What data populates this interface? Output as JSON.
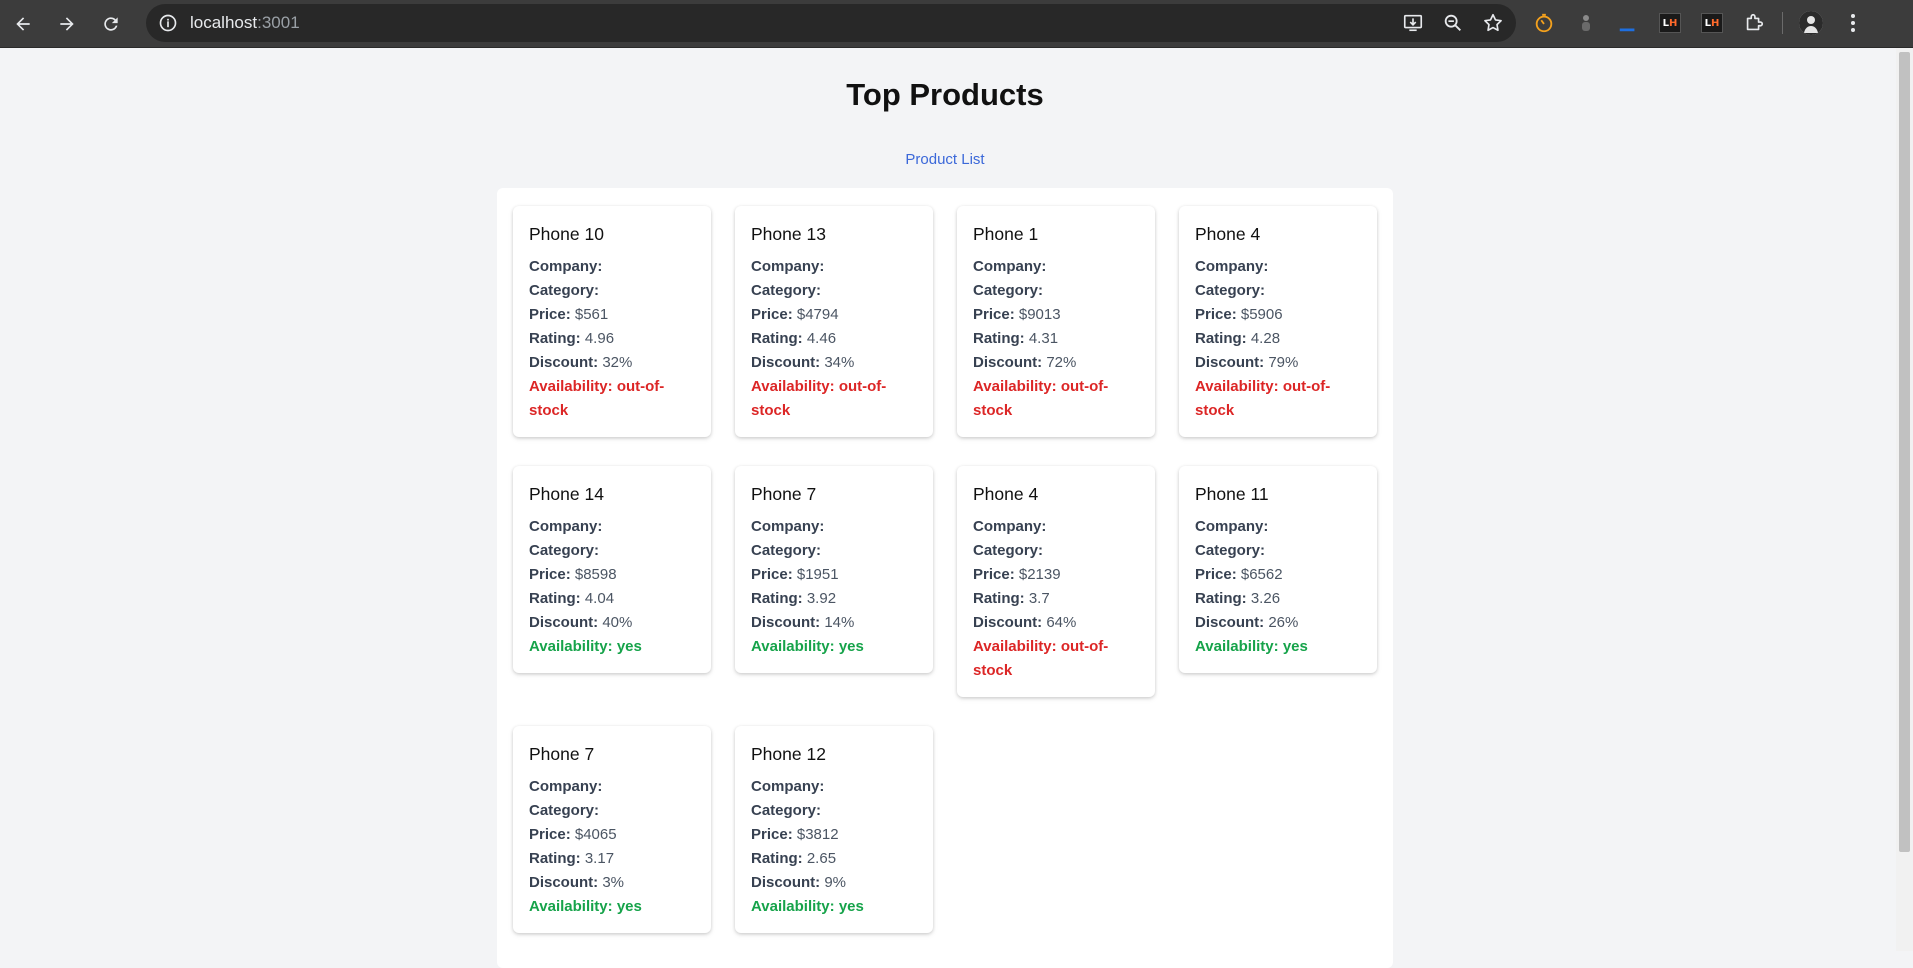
{
  "browser": {
    "url_host": "localhost",
    "url_port": ":3001"
  },
  "page": {
    "title": "Top Products",
    "link": "Product List"
  },
  "labels": {
    "company": "Company:",
    "category": "Category:",
    "price": "Price:",
    "rating": "Rating:",
    "discount": "Discount:",
    "availability": "Availability:"
  },
  "products": [
    {
      "name": "Phone 10",
      "price": "$561",
      "rating": "4.96",
      "discount": "32%",
      "availability": "out-of-stock"
    },
    {
      "name": "Phone 13",
      "price": "$4794",
      "rating": "4.46",
      "discount": "34%",
      "availability": "out-of-stock"
    },
    {
      "name": "Phone 1",
      "price": "$9013",
      "rating": "4.31",
      "discount": "72%",
      "availability": "out-of-stock"
    },
    {
      "name": "Phone 4",
      "price": "$5906",
      "rating": "4.28",
      "discount": "79%",
      "availability": "out-of-stock"
    },
    {
      "name": "Phone 14",
      "price": "$8598",
      "rating": "4.04",
      "discount": "40%",
      "availability": "yes"
    },
    {
      "name": "Phone 7",
      "price": "$1951",
      "rating": "3.92",
      "discount": "14%",
      "availability": "yes"
    },
    {
      "name": "Phone 4",
      "price": "$2139",
      "rating": "3.7",
      "discount": "64%",
      "availability": "out-of-stock"
    },
    {
      "name": "Phone 11",
      "price": "$6562",
      "rating": "3.26",
      "discount": "26%",
      "availability": "yes"
    },
    {
      "name": "Phone 7",
      "price": "$4065",
      "rating": "3.17",
      "discount": "3%",
      "availability": "yes"
    },
    {
      "name": "Phone 12",
      "price": "$3812",
      "rating": "2.65",
      "discount": "9%",
      "availability": "yes"
    }
  ],
  "colors": {
    "out_of_stock": "#dc2626",
    "in_stock": "#16a34a",
    "link": "#3b68d9"
  }
}
